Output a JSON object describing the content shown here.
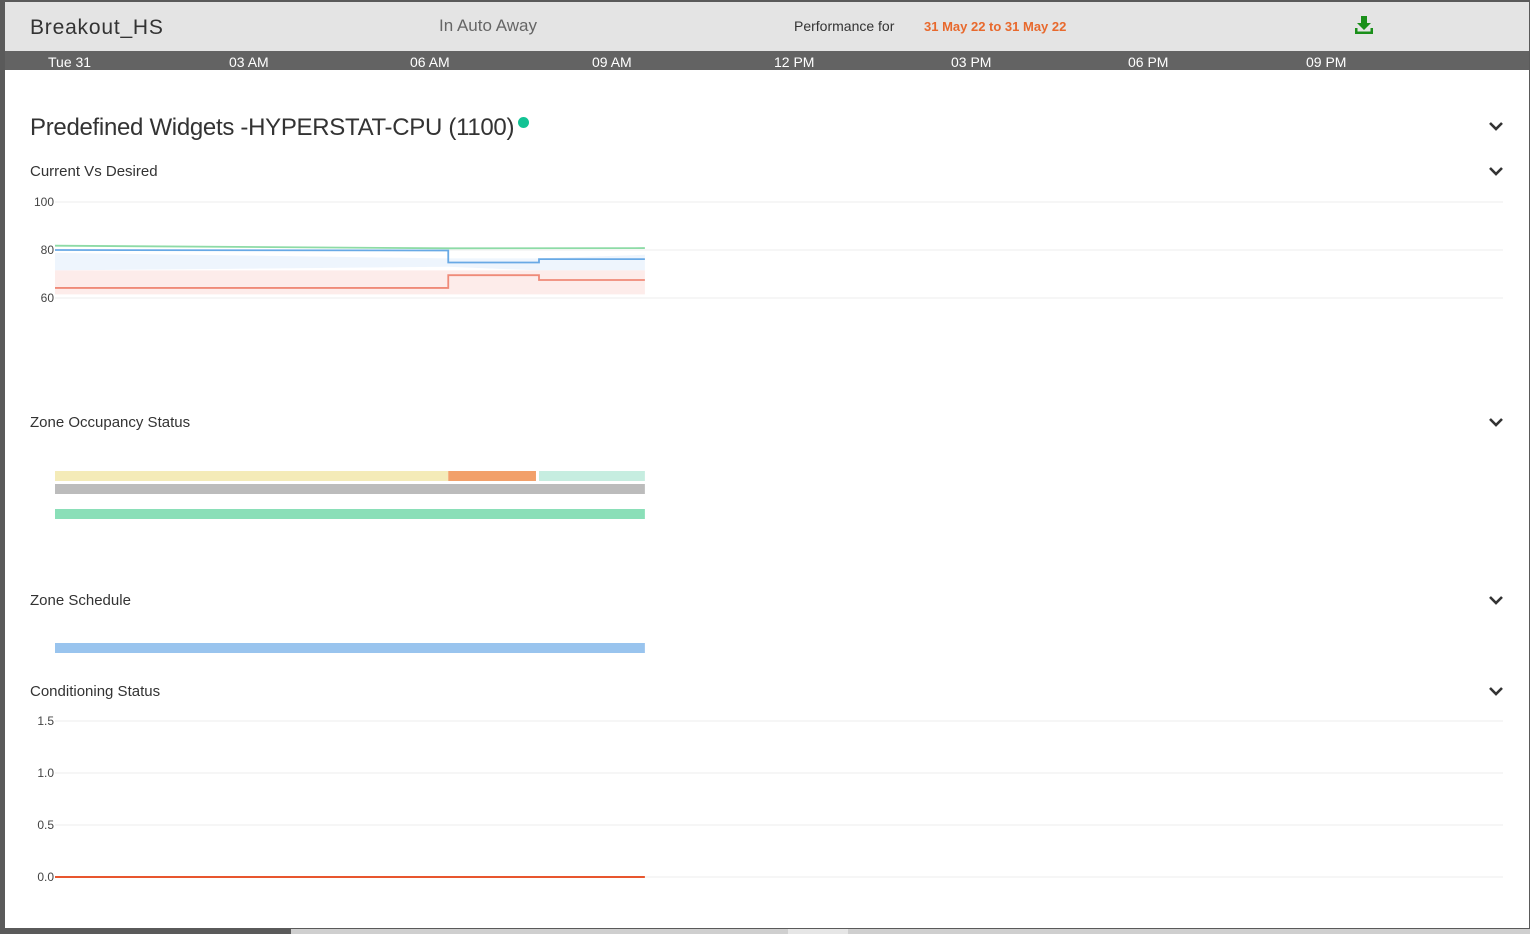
{
  "header": {
    "site_name": "Breakout_HS",
    "mode": "In Auto Away",
    "performance_label": "Performance for",
    "date_range": "31 May 22 to 31 May 22",
    "download_icon": "download-icon",
    "accent_color": "#e8692d",
    "download_color": "#1a8f1a"
  },
  "timeline": {
    "labels": [
      "Tue 31",
      "03 AM",
      "06 AM",
      "09 AM",
      "12 PM",
      "03 PM",
      "06 PM",
      "09 PM"
    ]
  },
  "widget_group": {
    "title": "Predefined Widgets -HYPERSTAT-CPU (1100)",
    "status_color": "#12c394"
  },
  "sections": {
    "current_vs_desired": {
      "title": "Current Vs Desired",
      "y_ticks": [
        "100",
        "80",
        "60"
      ]
    },
    "zone_occupancy": {
      "title": "Zone Occupancy Status"
    },
    "zone_schedule": {
      "title": "Zone Schedule"
    },
    "conditioning": {
      "title": "Conditioning Status",
      "y_ticks": [
        "1.5",
        "1.0",
        "0.5",
        "0.0"
      ]
    }
  },
  "chart_data": [
    {
      "type": "line",
      "x_unit": "hours",
      "xlim": [
        0,
        24
      ],
      "ylim": [
        60,
        100
      ],
      "yticks": [
        60,
        80,
        100
      ],
      "grid": true,
      "series": [
        {
          "color": "#8ddba6",
          "x": [
            0,
            6.5,
            9.75
          ],
          "y": [
            81.8,
            80.7,
            80.8
          ]
        },
        {
          "color": "#68a9e5",
          "x": [
            0,
            6.5,
            6.5,
            8.0,
            8.0,
            9.75
          ],
          "y": [
            80.0,
            79.8,
            74.8,
            74.8,
            76.2,
            76.2
          ]
        },
        {
          "color": "#ef8a78",
          "x": [
            0,
            6.5,
            6.5,
            8.0,
            8.0,
            9.75
          ],
          "y": [
            64.2,
            64.2,
            69.5,
            69.5,
            67.5,
            67.5
          ]
        }
      ],
      "bands": [
        {
          "color": "#eef5fd",
          "x": [
            0,
            6.5,
            8.0,
            9.75
          ],
          "y_low": [
            71.5,
            73.0,
            71.5,
            71.5
          ],
          "y_high": [
            78.8,
            76.5,
            76.5,
            78.0
          ]
        },
        {
          "color": "#fdecea",
          "x": [
            0,
            9.75
          ],
          "y_low": [
            61.5,
            61.5
          ],
          "y_high": [
            71.5,
            71.5
          ]
        }
      ]
    },
    {
      "type": "bar",
      "orientation": "horizontal",
      "xlim": [
        0,
        24
      ],
      "rows": [
        {
          "segments": [
            {
              "start": 0,
              "end": 6.5,
              "color": "#f4ebb8"
            },
            {
              "start": 6.5,
              "end": 7.95,
              "color": "#f2a06a"
            },
            {
              "start": 8.0,
              "end": 9.75,
              "color": "#c6ede0"
            }
          ]
        },
        {
          "segments": [
            {
              "start": 0,
              "end": 9.75,
              "color": "#bcbcbc"
            }
          ]
        },
        {
          "segments": [
            {
              "start": 0,
              "end": 9.75,
              "color": "#8adfb8"
            }
          ]
        }
      ]
    },
    {
      "type": "bar",
      "orientation": "horizontal",
      "xlim": [
        0,
        24
      ],
      "rows": [
        {
          "segments": [
            {
              "start": 0,
              "end": 9.75,
              "color": "#99c4ee"
            }
          ]
        }
      ]
    },
    {
      "type": "line",
      "x_unit": "hours",
      "xlim": [
        0,
        24
      ],
      "ylim": [
        0,
        1.5
      ],
      "yticks": [
        0,
        0.5,
        1.0,
        1.5
      ],
      "grid": true,
      "series": [
        {
          "color": "#e8562e",
          "x": [
            0,
            9.75
          ],
          "y": [
            0,
            0
          ]
        }
      ]
    }
  ]
}
